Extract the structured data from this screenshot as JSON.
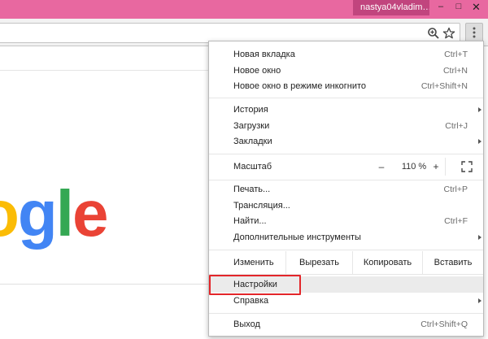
{
  "titlebar": {
    "user": "nastya04vladim…",
    "minimize": "–",
    "maximize": "□",
    "close": "✕",
    "color": "#e868a0"
  },
  "toolbar": {
    "icons": [
      "zoom-icon",
      "star-icon",
      "menu-icon"
    ]
  },
  "page": {
    "logo_text": "ogle",
    "logo_colors": [
      "#fbbc05",
      "#4285f4",
      "#34a853",
      "#ea4335"
    ]
  },
  "menu": {
    "new_tab": {
      "label": "Новая вкладка",
      "shortcut": "Ctrl+T"
    },
    "new_window": {
      "label": "Новое окно",
      "shortcut": "Ctrl+N"
    },
    "incognito": {
      "label": "Новое окно в режиме инкогнито",
      "shortcut": "Ctrl+Shift+N"
    },
    "history": {
      "label": "История"
    },
    "downloads": {
      "label": "Загрузки",
      "shortcut": "Ctrl+J"
    },
    "bookmarks": {
      "label": "Закладки"
    },
    "zoom": {
      "label": "Масштаб",
      "minus": "–",
      "value": "110 %",
      "plus": "+"
    },
    "print": {
      "label": "Печать...",
      "shortcut": "Ctrl+P"
    },
    "cast": {
      "label": "Трансляция..."
    },
    "find": {
      "label": "Найти...",
      "shortcut": "Ctrl+F"
    },
    "more_tools": {
      "label": "Дополнительные инструменты"
    },
    "edit": {
      "label": "Изменить",
      "cut": "Вырезать",
      "copy": "Копировать",
      "paste": "Вставить"
    },
    "settings": {
      "label": "Настройки"
    },
    "help": {
      "label": "Справка"
    },
    "exit": {
      "label": "Выход",
      "shortcut": "Ctrl+Shift+Q"
    },
    "highlight_color": "#e3262a"
  }
}
